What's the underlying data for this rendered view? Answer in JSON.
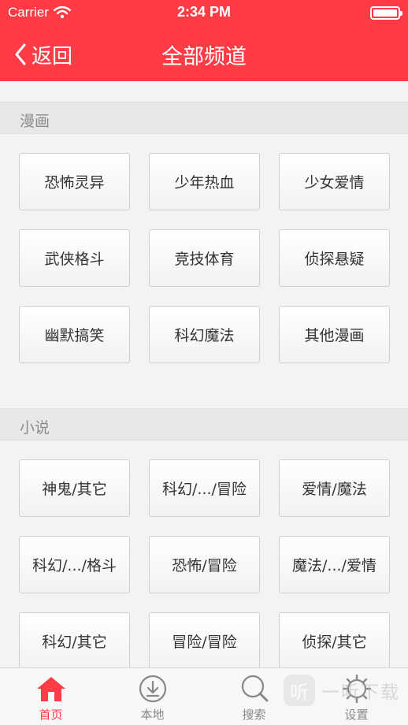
{
  "status_bar": {
    "carrier": "Carrier",
    "time": "2:34 PM",
    "battery_percent": 100
  },
  "header": {
    "back_label": "返回",
    "title": "全部频道"
  },
  "sections": [
    {
      "title": "漫画",
      "items": [
        "恐怖灵异",
        "少年热血",
        "少女爱情",
        "武侠格斗",
        "竞技体育",
        "侦探悬疑",
        "幽默搞笑",
        "科幻魔法",
        "其他漫画"
      ]
    },
    {
      "title": "小说",
      "items": [
        "神鬼/其它",
        "科幻/.../冒险",
        "爱情/魔法",
        "科幻/.../格斗",
        "恐怖/冒险",
        "魔法/.../爱情",
        "科幻/其它",
        "冒险/冒险",
        "侦探/其它"
      ]
    }
  ],
  "tabbar": {
    "active": 0,
    "tabs": [
      {
        "label": "首页",
        "icon": "home-icon"
      },
      {
        "label": "本地",
        "icon": "download-icon"
      },
      {
        "label": "搜索",
        "icon": "search-icon"
      },
      {
        "label": "设置",
        "icon": "settings-icon"
      }
    ]
  },
  "watermark": {
    "logo_char": "听",
    "text": "一听下载"
  },
  "colors": {
    "accent": "#ff3b46",
    "tab_inactive": "#888888",
    "section_text": "#8b8b8b"
  }
}
